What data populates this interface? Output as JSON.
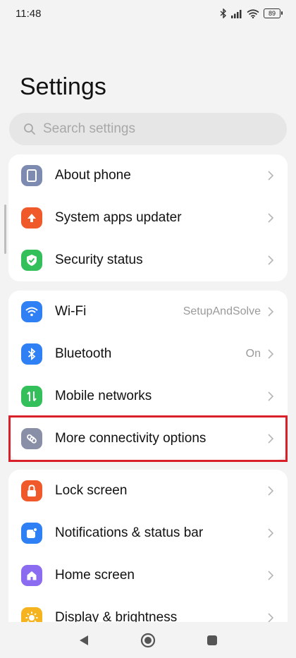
{
  "status_bar": {
    "time": "11:48",
    "battery": "89",
    "icons": [
      "bluetooth-icon",
      "signal-icon",
      "wifi-icon",
      "battery-icon"
    ]
  },
  "header": {
    "title": "Settings"
  },
  "search": {
    "placeholder": "Search settings"
  },
  "groups": [
    {
      "items": [
        {
          "label": "About phone",
          "icon": "phone-icon",
          "color": "#7d8bb0"
        },
        {
          "label": "System apps updater",
          "icon": "upload-arrow-icon",
          "color": "#f05a2a"
        },
        {
          "label": "Security status",
          "icon": "shield-check-icon",
          "color": "#33c05a"
        }
      ]
    },
    {
      "items": [
        {
          "label": "Wi-Fi",
          "value": "SetupAndSolve",
          "icon": "wifi-icon",
          "color": "#2f7ff5"
        },
        {
          "label": "Bluetooth",
          "value": "On",
          "icon": "bluetooth-icon",
          "color": "#2f7ff5"
        },
        {
          "label": "Mobile networks",
          "icon": "mobile-data-icon",
          "color": "#33c05a"
        },
        {
          "label": "More connectivity options",
          "icon": "link-icon",
          "color": "#8a8fa8"
        }
      ]
    },
    {
      "items": [
        {
          "label": "Lock screen",
          "icon": "lock-icon",
          "color": "#f05a2a"
        },
        {
          "label": "Notifications & status bar",
          "icon": "notification-icon",
          "color": "#2f7ff5"
        },
        {
          "label": "Home screen",
          "icon": "home-icon",
          "color": "#8b6cf0"
        },
        {
          "label": "Display & brightness",
          "icon": "sun-icon",
          "color": "#f5b41f"
        }
      ]
    }
  ],
  "colors": {
    "highlight": "#d9202a",
    "background": "#f3f3f3",
    "card": "#ffffff"
  },
  "nav": {
    "buttons": [
      "back-icon",
      "home-button-icon",
      "recents-icon"
    ]
  }
}
